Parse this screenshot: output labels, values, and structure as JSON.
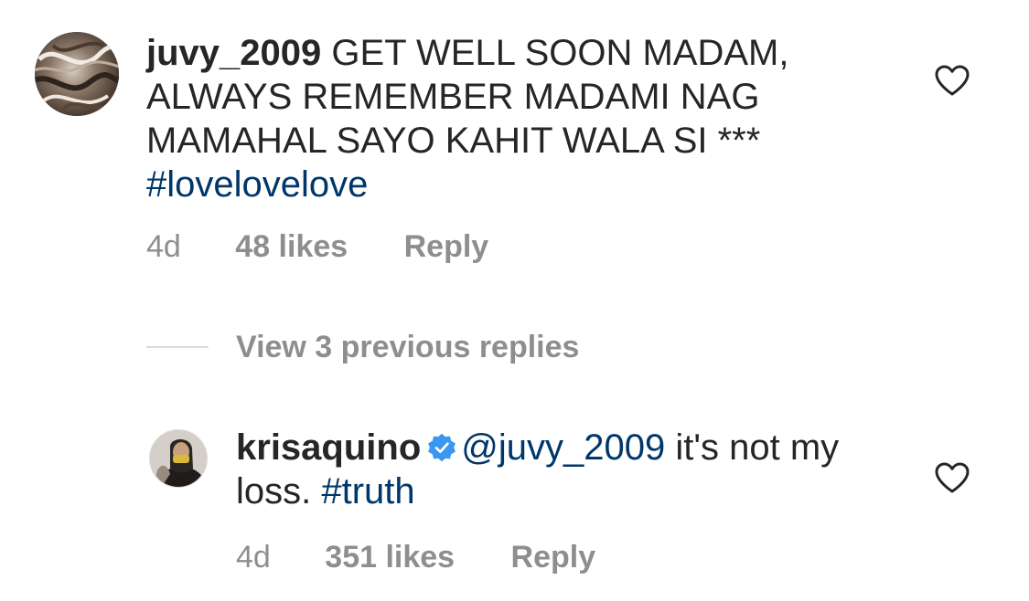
{
  "comment": {
    "username": "juvy_2009",
    "text": "GET WELL SOON MADAM, ALWAYS REMEMBER MADAMI NAG MAMAHAL SAYO KAHIT WALA SI ***",
    "hashtag": "#lovelovelove",
    "time": "4d",
    "likes": "48 likes",
    "reply": "Reply",
    "avatar_icon": "marbled-avatar",
    "like_icon": "heart-outline-icon"
  },
  "view_replies": {
    "label": "View 3 previous replies"
  },
  "reply_comment": {
    "username": "krisaquino",
    "verified_icon": "verified-badge-icon",
    "mention": "@juvy_2009",
    "text": "it's not my loss.",
    "hashtag": "#truth",
    "time": "4d",
    "likes": "351 likes",
    "reply": "Reply",
    "like_icon": "heart-outline-icon"
  },
  "colors": {
    "username": "#262626",
    "link": "#00376b",
    "meta": "#8e8e8e",
    "verified": "#3897f0"
  }
}
